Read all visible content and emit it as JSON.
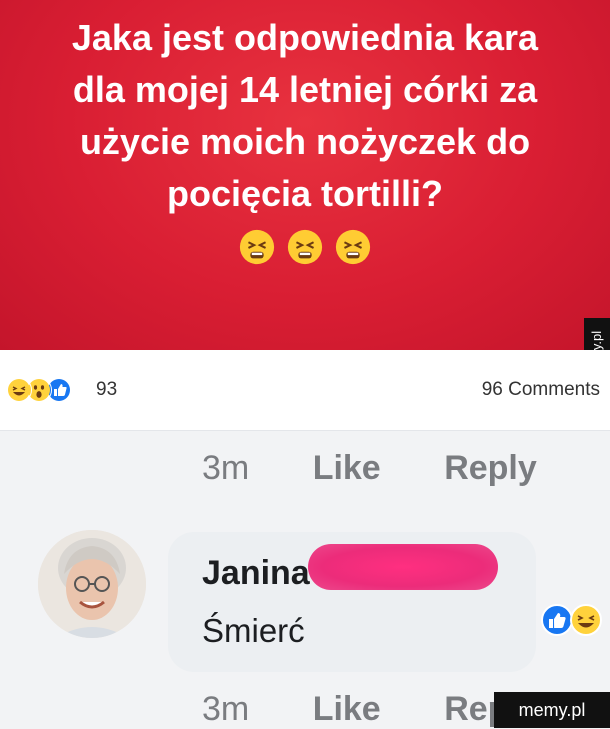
{
  "post": {
    "question_lines": [
      "Jaka jest odpowiednia kara",
      "dla mojej 14 letniej córki za",
      "użycie moich nożyczek do",
      "pocięcia tortilli?"
    ],
    "emoji_count": 3,
    "background_color": "#d91e33"
  },
  "reactions": {
    "icons": [
      "laughing-emoji",
      "wow-emoji",
      "like-icon"
    ],
    "count": "93",
    "comments": "96 Comments"
  },
  "comment_actions_top": {
    "time": "3m",
    "like": "Like",
    "reply": "Reply"
  },
  "comment": {
    "name": "Janina",
    "text": "Śmierć",
    "reactions": [
      "like-icon",
      "laughing-emoji"
    ]
  },
  "comment_actions_bottom": {
    "time": "3m",
    "like": "Like",
    "reply": "Rep"
  },
  "watermarks": {
    "side": "memy.pl",
    "footer": "memy.pl"
  }
}
